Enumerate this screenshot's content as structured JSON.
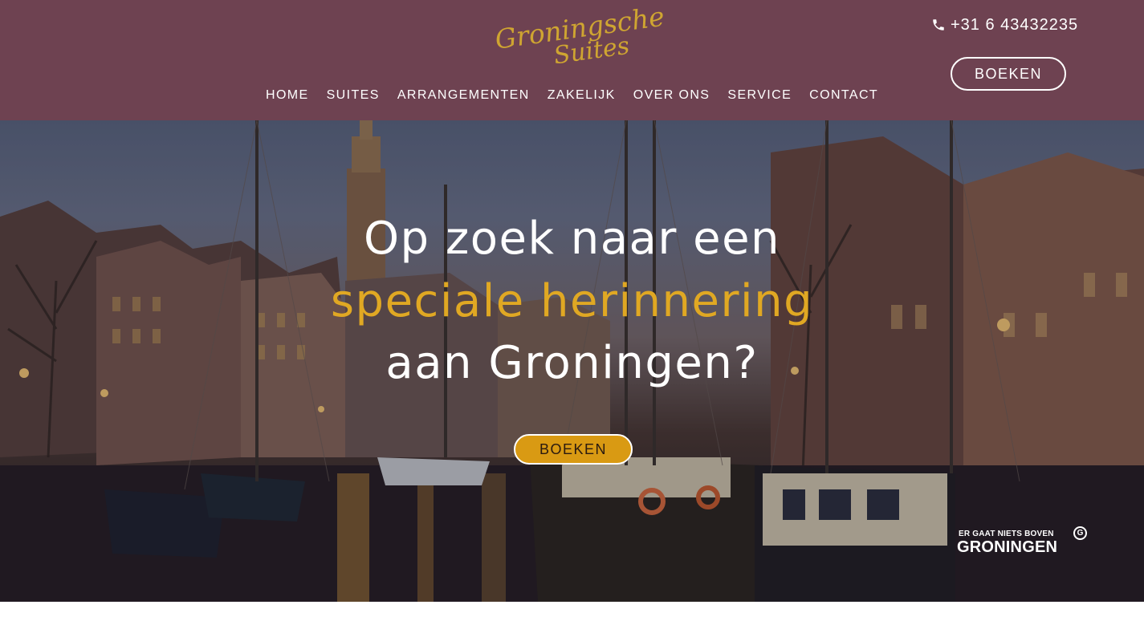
{
  "header": {
    "logo_line1": "Groningsche",
    "logo_line2": "Suites",
    "phone": "+31 6 43432235",
    "book_label": "BOEKEN",
    "nav": [
      "HOME",
      "SUITES",
      "ARRANGEMENTEN",
      "ZAKELIJK",
      "OVER ONS",
      "SERVICE",
      "CONTACT"
    ]
  },
  "hero": {
    "line1": "Op zoek naar een",
    "line2": "speciale herinnering",
    "line3": "aan Groningen?",
    "book_label": "BOEKEN",
    "badge_small": "ER GAAT NIETS BOVEN",
    "badge_big": "GRONINGEN",
    "badge_mark": "G"
  },
  "colors": {
    "header_bg": "#6e4251",
    "accent_gold": "#e0a823",
    "logo_gold": "#cfa531",
    "button_gold": "#d99a13"
  },
  "icons": [
    "phone-icon"
  ]
}
